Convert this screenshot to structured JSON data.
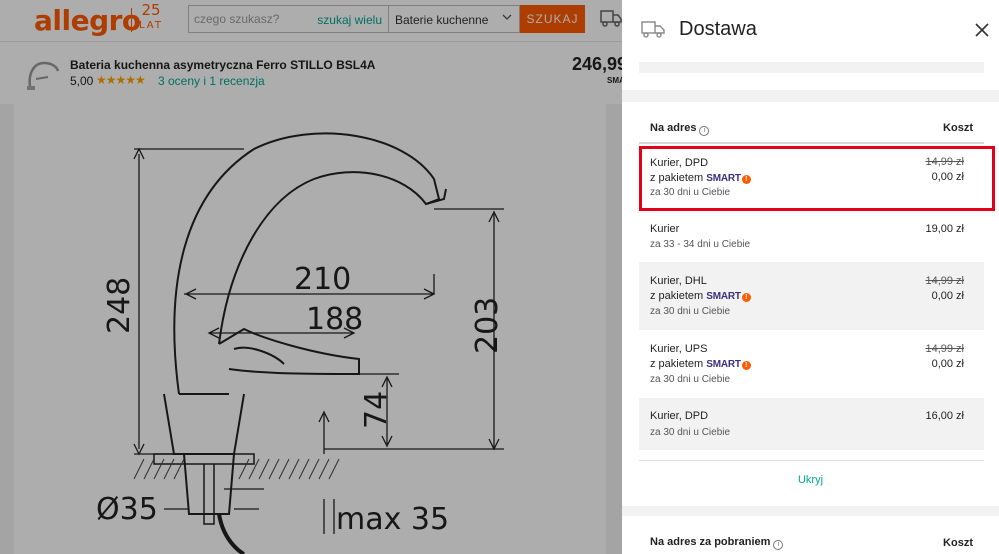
{
  "header": {
    "logo": "allegro",
    "anniversary_number": "25",
    "anniversary_word": "LAT",
    "search_placeholder": "czego szukasz?",
    "search_many_label": "szukaj wielu",
    "category_value": "Baterie kuchenne",
    "search_button": "SZUKAJ"
  },
  "product": {
    "title": "Bateria kuchenna asymetryczna Ferro STILLO BSL4A",
    "rating_value": "5,00",
    "stars": "★★★★★",
    "rating_link": "3 oceny i 1 recenzja",
    "price": "246,99",
    "price_badge": "SMA"
  },
  "drawing": {
    "dim_248": "248",
    "dim_210": "210",
    "dim_188": "188",
    "dim_203": "203",
    "dim_74": "74",
    "dim_35": "Ø35",
    "dim_max35": "max 35"
  },
  "drawer": {
    "title": "Dostawa",
    "section1": {
      "heading": "Na adres",
      "cost_heading": "Koszt",
      "options": [
        {
          "name": "Kurier, DPD",
          "smart_prefix": "z pakietem",
          "smart_label": "SMART",
          "days": "za 30 dni u Ciebie",
          "old_price": "14,99 zł",
          "price": "0,00 zł"
        },
        {
          "name": "Kurier",
          "days": "za 33 - 34 dni u Ciebie",
          "price": "19,00 zł"
        },
        {
          "name": "Kurier, DHL",
          "smart_prefix": "z pakietem",
          "smart_label": "SMART",
          "days": "za 30 dni u Ciebie",
          "old_price": "14,99 zł",
          "price": "0,00 zł"
        },
        {
          "name": "Kurier, UPS",
          "smart_prefix": "z pakietem",
          "smart_label": "SMART",
          "days": "za 30 dni u Ciebie",
          "old_price": "14,99 zł",
          "price": "0,00 zł"
        },
        {
          "name": "Kurier, DPD",
          "days": "za 30 dni u Ciebie",
          "price": "16,00 zł"
        }
      ],
      "hide_link": "Ukryj"
    },
    "section2": {
      "heading": "Na adres za pobraniem",
      "cost_heading": "Koszt"
    }
  },
  "colors": {
    "brand": "#ff5a00",
    "link": "#00a790",
    "highlight": "#e3001b",
    "smart": "#3b2f7f"
  }
}
